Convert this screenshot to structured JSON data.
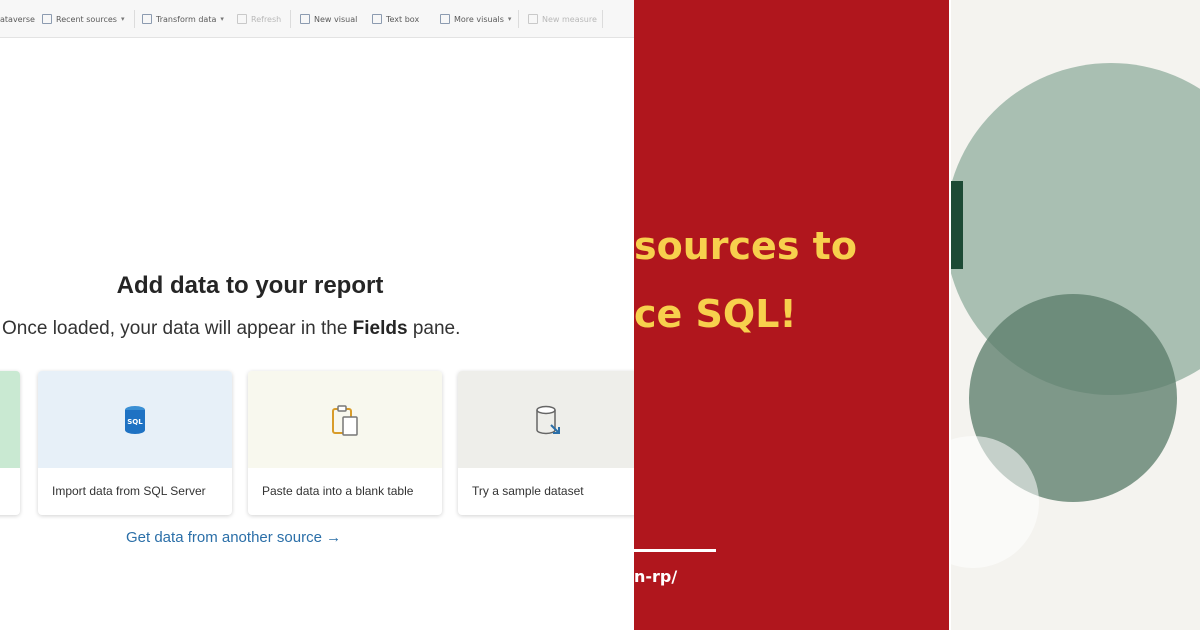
{
  "toolbar": {
    "items": [
      "ataverse",
      "Recent sources",
      "Transform data",
      "Refresh",
      "New visual",
      "Text box",
      "More visuals",
      "New measure"
    ]
  },
  "main": {
    "title": "Add data to your report",
    "subtitle_pre": "Once loaded, your data will appear in the ",
    "subtitle_bold": "Fields",
    "subtitle_post": " pane.",
    "cards": [
      {
        "label": "Import data from SQL Server",
        "icon": "sql-server-icon",
        "color": "#e7f0f8"
      },
      {
        "label": "Paste data into a blank table",
        "icon": "paste-table-icon",
        "color": "#f8f8ee"
      },
      {
        "label": "Try a sample dataset",
        "icon": "sample-dataset-icon",
        "color": "#eeeeea"
      }
    ],
    "link": "Get data from another source →"
  },
  "banner": {
    "line1": "sources to",
    "line2": "ce SQL!",
    "url": "n-rp/"
  },
  "colors": {
    "red": "#b0161d",
    "yellow": "#f7d04d",
    "sage": "#a9bfb2",
    "green_dark": "#5c7d6b",
    "link_blue": "#2b6fa8"
  }
}
